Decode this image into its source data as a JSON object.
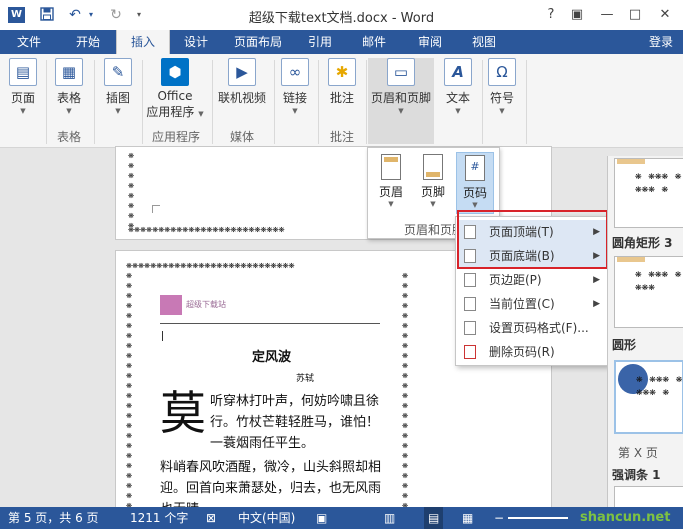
{
  "window": {
    "title": "超级下载text文档.docx - Word",
    "help": "?",
    "restore_ribbon": "▣",
    "minimize": "—",
    "maximize": "□",
    "close": "✕"
  },
  "quick_access": {
    "app_icon": "W",
    "save_icon": "floppy-icon",
    "undo_icon": "undo-icon",
    "redo_icon": "redo-icon",
    "customize_icon": "dropdown-icon"
  },
  "tabs": [
    "文件",
    "开始",
    "插入",
    "设计",
    "页面布局",
    "引用",
    "邮件",
    "审阅",
    "视图"
  ],
  "active_tab": "插入",
  "login": "登录",
  "ribbon": {
    "page": "页面",
    "table": "表格",
    "table_group": "表格",
    "illustration": "插图",
    "office_apps_line1": "Office",
    "office_apps_line2": "应用程序",
    "apps_group": "应用程序",
    "online_video": "联机视频",
    "media_group": "媒体",
    "link": "链接",
    "comment": "批注",
    "comment_group": "批注",
    "header_footer": "页眉和页脚",
    "text": "文本",
    "symbol": "符号"
  },
  "header_footer_panel": {
    "header": "页眉",
    "footer": "页脚",
    "page_number": "页码",
    "group_label": "页眉和页脚"
  },
  "page_number_menu": {
    "items": [
      {
        "label": "页面顶端(T)",
        "submenu": true
      },
      {
        "label": "页面底端(B)",
        "submenu": true
      },
      {
        "label": "页边距(P)",
        "submenu": true
      },
      {
        "label": "当前位置(C)",
        "submenu": true
      },
      {
        "label": "设置页码格式(F)...",
        "submenu": false
      },
      {
        "label": "删除页码(R)",
        "submenu": false
      }
    ]
  },
  "gallery": {
    "label_rounded": "圆角矩形 3",
    "label_circle": "圆形",
    "label_x_page": "第 X 页",
    "label_accent": "强调条 1"
  },
  "document": {
    "header_text": "超级下载站",
    "poem_title": "定风波",
    "author": "苏轼",
    "drop_cap": "莫",
    "line1": "听穿林打叶声，何妨吟啸且徐",
    "line2": "行。竹杖芒鞋轻胜马，谁怕！",
    "line3": "一蓑烟雨任平生。",
    "line4": "料峭春风吹酒醒，微冷，山头斜照却相",
    "line5": "迎。回首向来萧瑟处，归去，也无风雨",
    "line6": "也无晴。"
  },
  "status": {
    "page": "第 5 页，共 6 页",
    "words": "1211 个字",
    "language": "中文(中国)",
    "watermark": "shancun.net"
  },
  "colors": {
    "word_blue": "#2b579a",
    "highlight_red": "#d8232a"
  }
}
